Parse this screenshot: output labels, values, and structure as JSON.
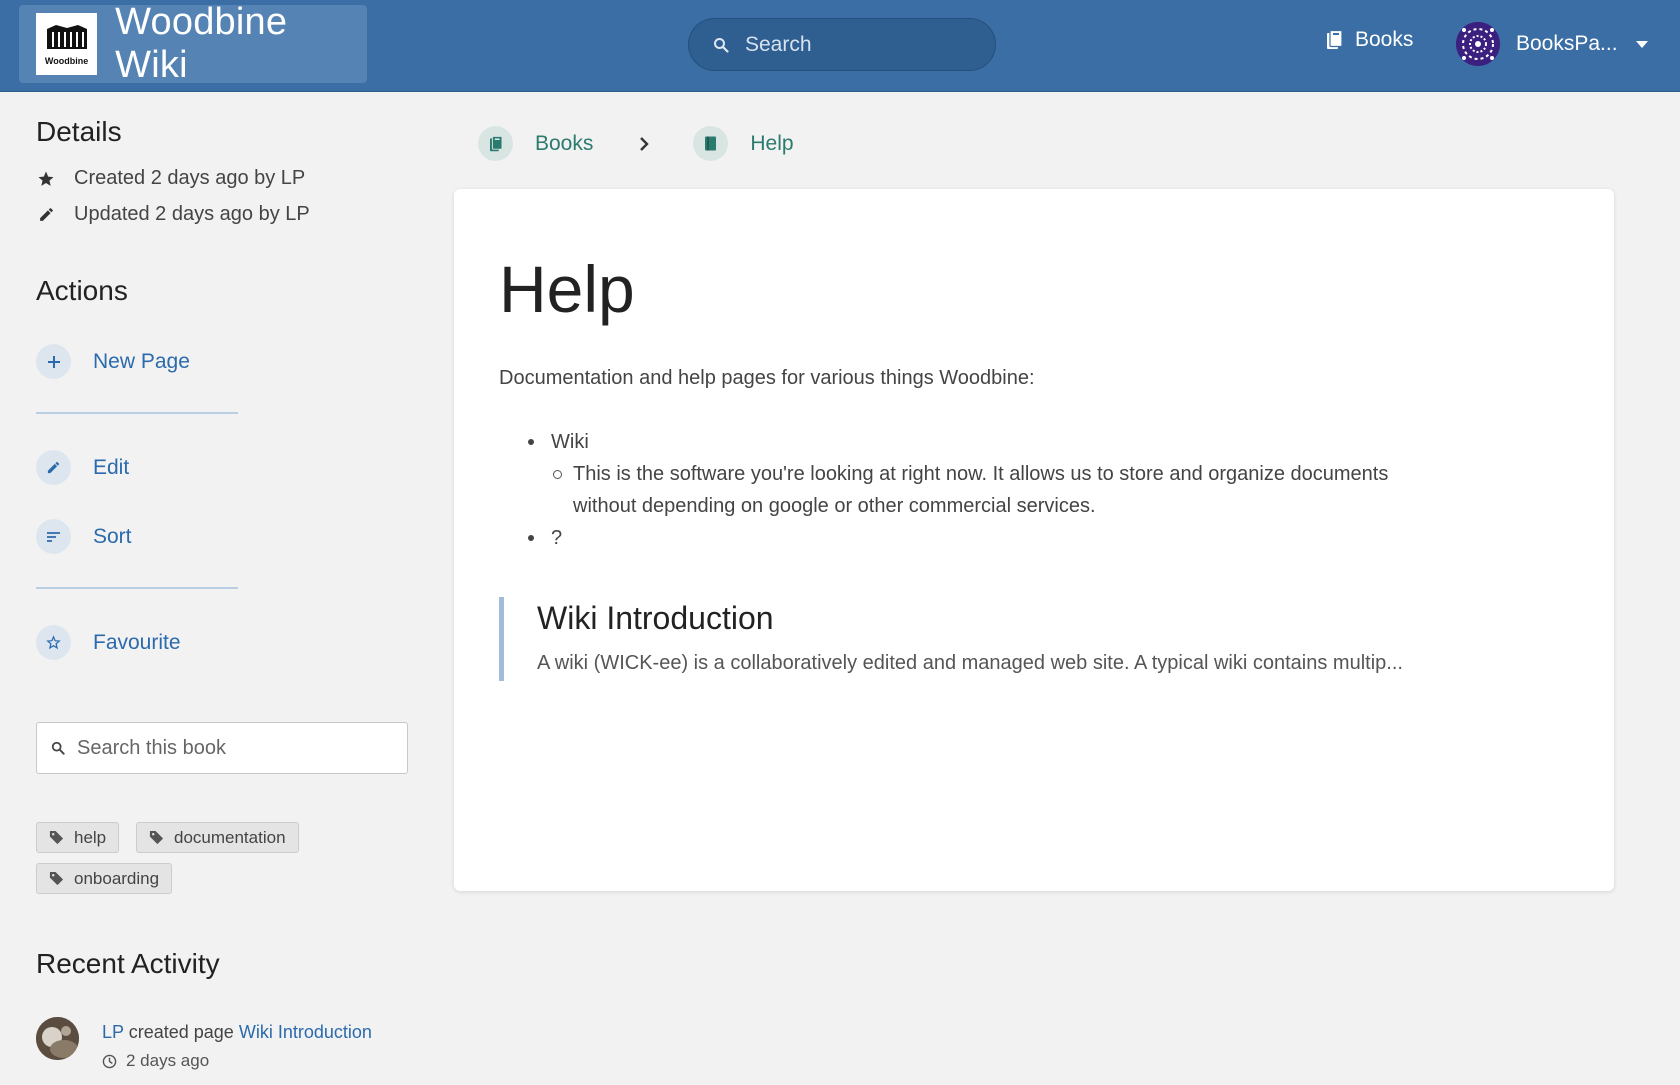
{
  "header": {
    "brand_logo_text": "Woodbine",
    "brand_name": "Woodbine Wiki",
    "search_placeholder": "Search",
    "books_label": "Books",
    "user_name": "BooksPa..."
  },
  "sidebar": {
    "details_title": "Details",
    "created": "Created 2 days ago by LP",
    "updated": "Updated 2 days ago by LP",
    "actions_title": "Actions",
    "actions": {
      "new_page": "New Page",
      "edit": "Edit",
      "sort": "Sort",
      "favourite": "Favourite"
    },
    "book_search_placeholder": "Search this book",
    "tags": [
      "help",
      "documentation",
      "onboarding"
    ],
    "recent_title": "Recent Activity",
    "recent": {
      "user": "LP",
      "action": "created page",
      "page": "Wiki Introduction",
      "time": "2 days ago"
    }
  },
  "breadcrumb": {
    "books": "Books",
    "current": "Help"
  },
  "content": {
    "title": "Help",
    "intro": "Documentation and help pages for various things Woodbine:",
    "list_item_1": "Wiki",
    "list_sub_1": "This is the software you're looking at right now. It allows us to store and organize documents without depending on google or other commercial services.",
    "list_item_2": "?",
    "entity_title": "Wiki Introduction",
    "entity_desc": "A wiki (WICK-ee) is a collaboratively edited and managed web site. A typical wiki contains multip..."
  },
  "colors": {
    "header": "#3a6ea5",
    "link": "#2b6aad",
    "book_green": "#2b7a6e",
    "background": "#f2f2f2"
  }
}
